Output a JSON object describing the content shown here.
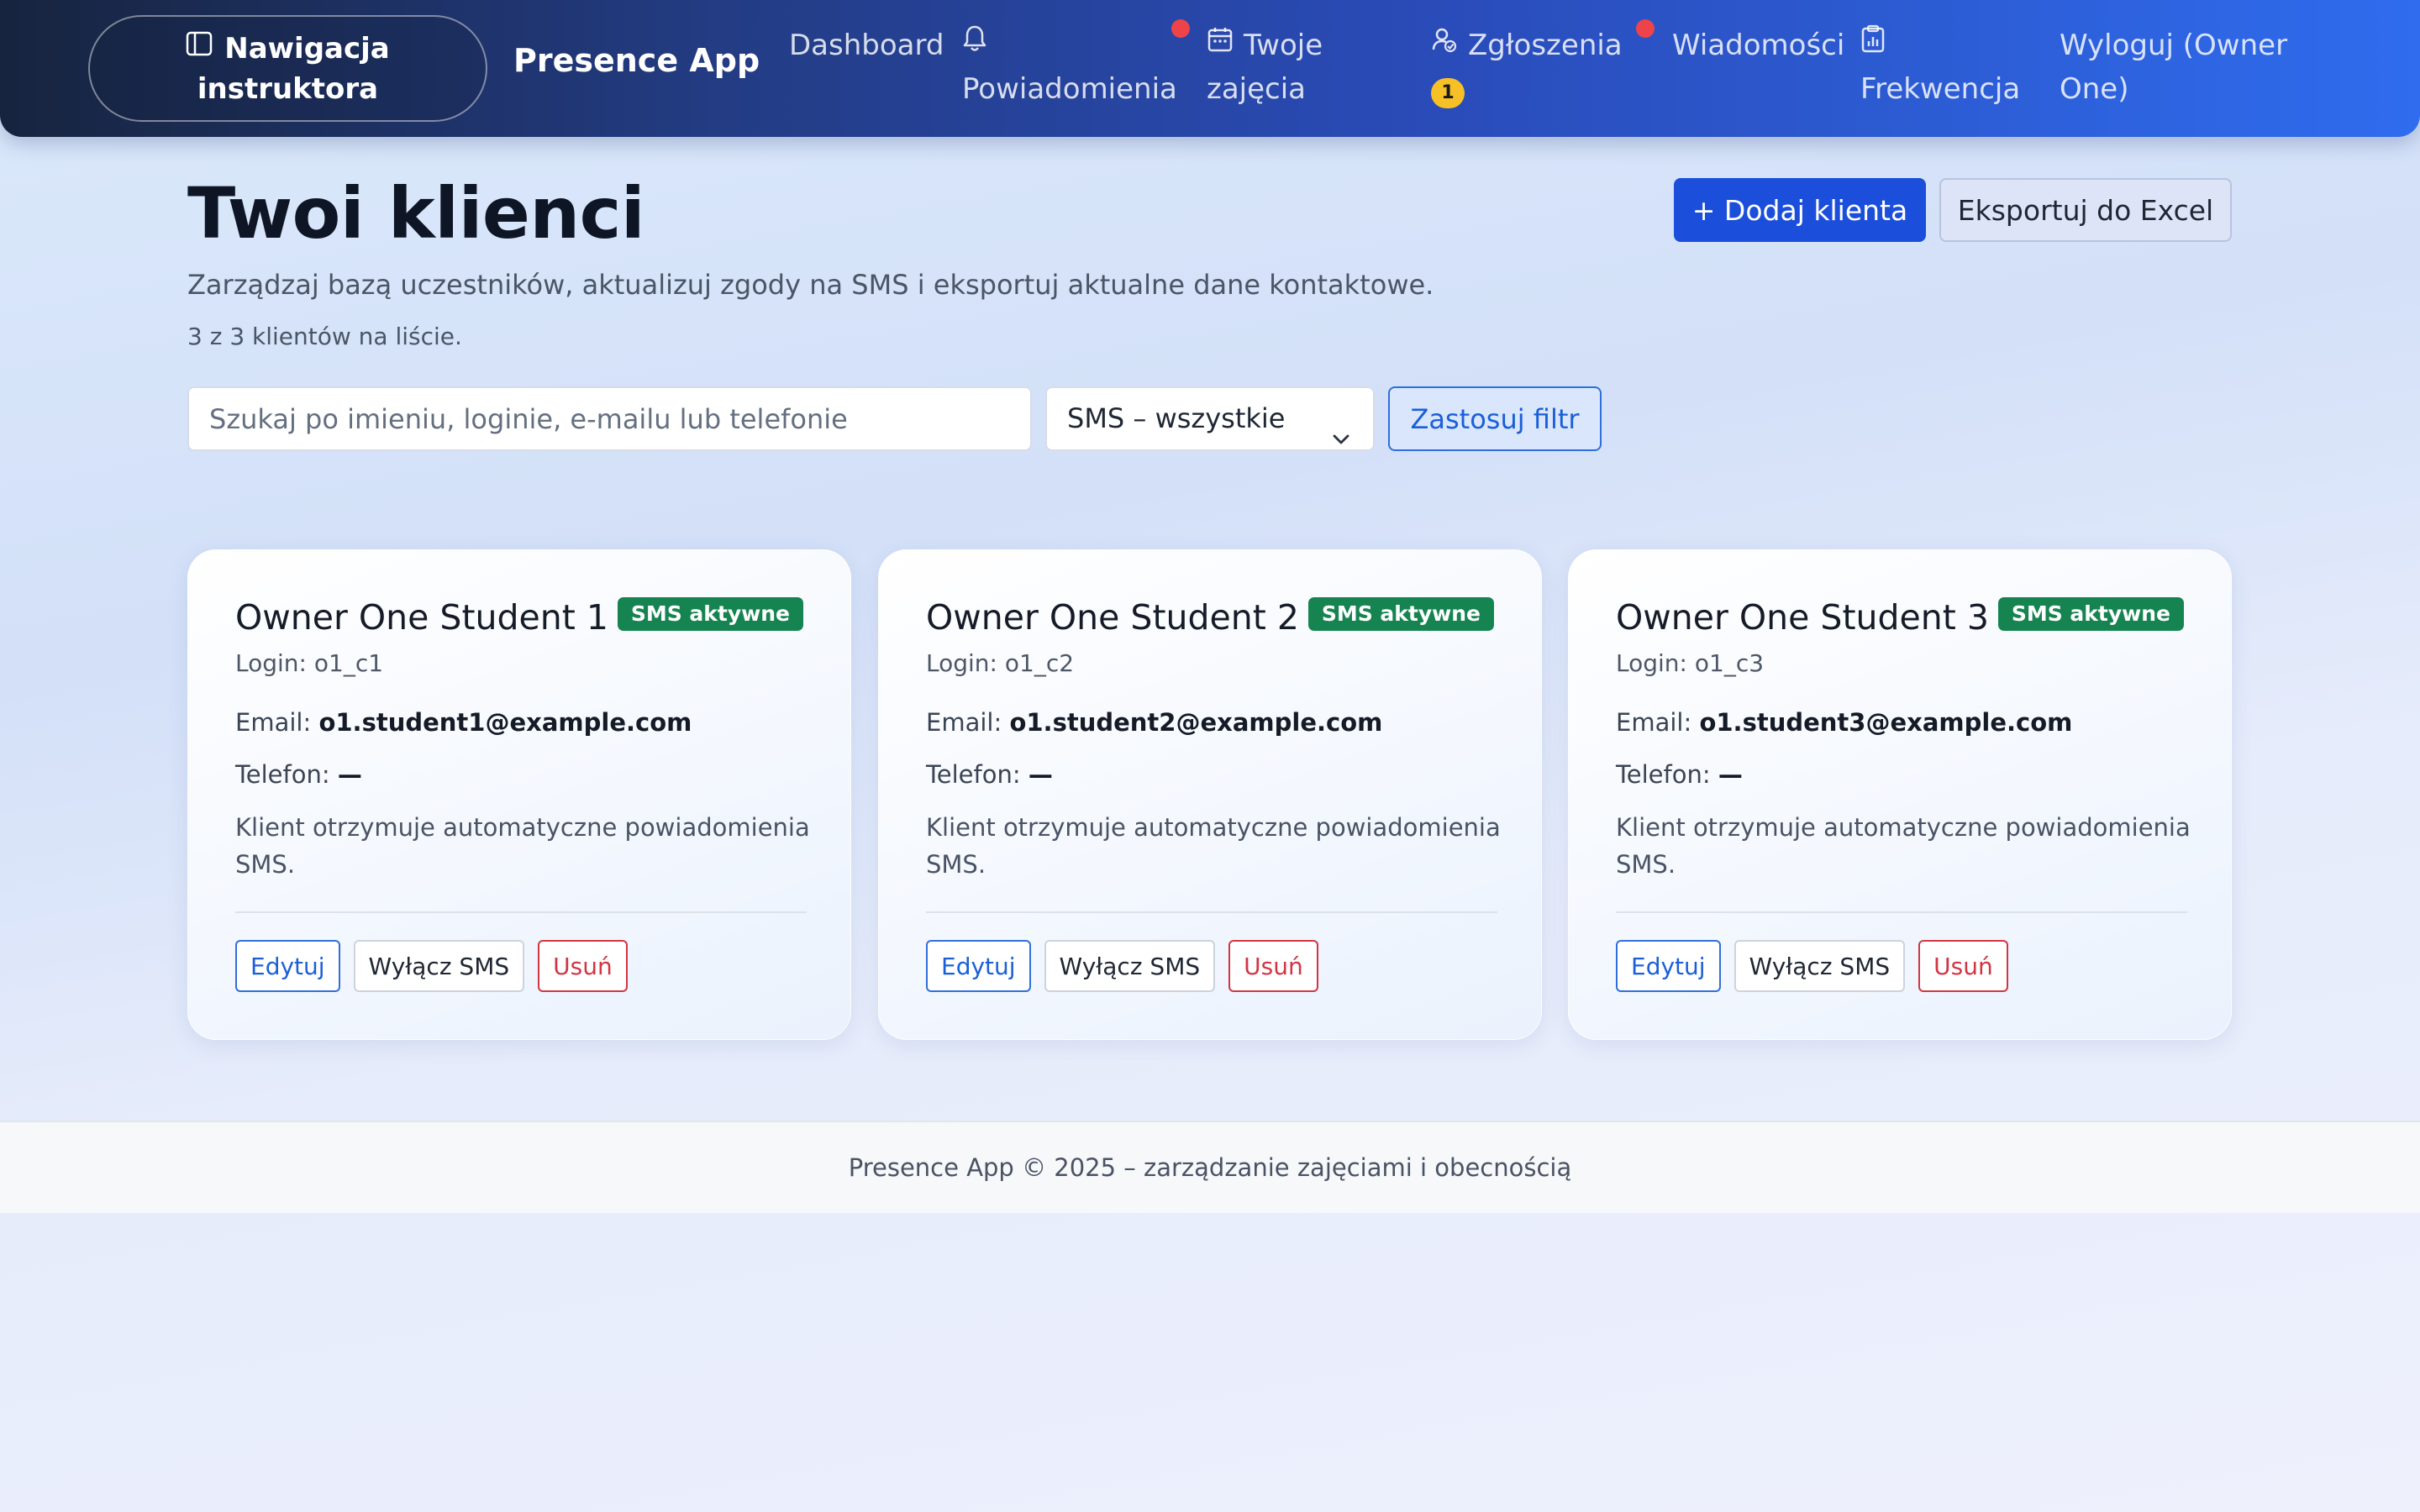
{
  "nav": {
    "toggle_line1": "Nawigacja",
    "toggle_line2": "instruktora",
    "brand": "Presence App",
    "dashboard": "Dashboard",
    "notifications": "Powiadomienia",
    "classes_line1": "Twoje",
    "classes_line2": "zajęcia",
    "requests": "Zgłoszenia",
    "requests_badge": "1",
    "messages": "Wiadomości",
    "attendance": "Frekwencja",
    "logout_line1": "Wyloguj (Owner",
    "logout_line2": "One)"
  },
  "header": {
    "title": "Twoi klienci",
    "description": "Zarządzaj bazą uczestników, aktualizuj zgody na SMS i eksportuj aktualne dane kontaktowe.",
    "count": "3 z 3 klientów na liście.",
    "add_button": "+ Dodaj klienta",
    "export_button": "Eksportuj do Excel"
  },
  "filters": {
    "search_placeholder": "Szukaj po imieniu, loginie, e-mailu lub telefonie",
    "sms_select_value": "SMS – wszystkie",
    "apply_button": "Zastosuj filtr"
  },
  "cards": [
    {
      "name": "Owner One Student 1",
      "badge": "SMS aktywne",
      "login": "Login: o1_c1",
      "email_label": "Email:",
      "email": "o1.student1@example.com",
      "phone_label": "Telefon:",
      "phone": "—",
      "note": "Klient otrzymuje automatyczne powiadomienia SMS.",
      "edit": "Edytuj",
      "sms_toggle": "Wyłącz SMS",
      "delete": "Usuń"
    },
    {
      "name": "Owner One Student 2",
      "badge": "SMS aktywne",
      "login": "Login: o1_c2",
      "email_label": "Email:",
      "email": "o1.student2@example.com",
      "phone_label": "Telefon:",
      "phone": "—",
      "note": "Klient otrzymuje automatyczne powiadomienia SMS.",
      "edit": "Edytuj",
      "sms_toggle": "Wyłącz SMS",
      "delete": "Usuń"
    },
    {
      "name": "Owner One Student 3",
      "badge": "SMS aktywne",
      "login": "Login: o1_c3",
      "email_label": "Email:",
      "email": "o1.student3@example.com",
      "phone_label": "Telefon:",
      "phone": "—",
      "note": "Klient otrzymuje automatyczne powiadomienia SMS.",
      "edit": "Edytuj",
      "sms_toggle": "Wyłącz SMS",
      "delete": "Usuń"
    }
  ],
  "footer": {
    "text": "Presence App © 2025 – zarządzanie zajęciami i obecnością"
  },
  "colors": {
    "primary": "#1b4fdb",
    "sms_badge": "#168451",
    "danger": "#d23542",
    "notification_dot": "#ee4449",
    "badge_yellow": "#f6c026"
  },
  "icons": {
    "toggle": "sidebar-icon",
    "notifications": "bell-icon",
    "classes": "calendar-icon",
    "requests": "user-check-icon",
    "attendance": "clipboard-chart-icon",
    "select": "chevron-down-icon"
  }
}
